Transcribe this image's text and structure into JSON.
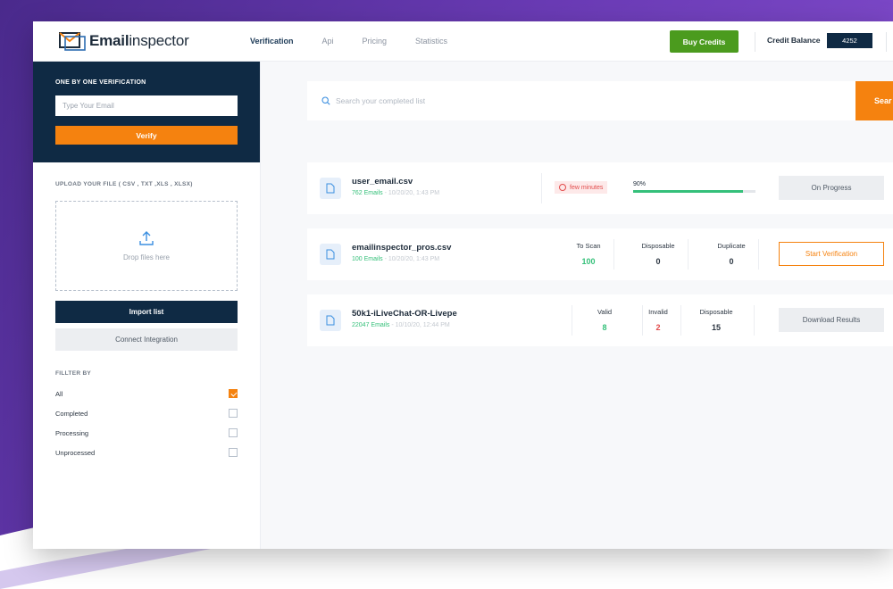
{
  "header": {
    "logo_bold": "Email",
    "logo_rest": "inspector",
    "nav": [
      {
        "label": "Verification",
        "active": true
      },
      {
        "label": "Api",
        "active": false
      },
      {
        "label": "Pricing",
        "active": false
      },
      {
        "label": "Statistics",
        "active": false
      }
    ],
    "buy_credits": "Buy Credits",
    "credit_balance_label": "Credit Balance",
    "credit_balance_value": "4252"
  },
  "sidebar": {
    "verify_title": "ONE BY ONE VERIFICATION",
    "email_placeholder": "Type Your Email",
    "verify_button": "Verify",
    "upload_label": "UPLOAD YOUR FILE ( CSV , TXT ,XLS , XLSX)",
    "drop_text": "Drop files here",
    "import_button": "Import list",
    "connect_button": "Connect Integration",
    "filter_label": "FILLTER BY",
    "filters": [
      {
        "label": "All",
        "checked": true
      },
      {
        "label": "Completed",
        "checked": false
      },
      {
        "label": "Processing",
        "checked": false
      },
      {
        "label": "Unprocessed",
        "checked": false
      }
    ]
  },
  "search": {
    "placeholder": "Search your completed list",
    "button": "Sear"
  },
  "lists": [
    {
      "name": "user_email.csv",
      "count": "762 Emails",
      "date": " - 10/20/20, 1:43 PM",
      "time_badge": "few minutes",
      "progress_label": "90%",
      "progress": 0.9,
      "action": "On Progress"
    },
    {
      "name": "emailinspector_pros.csv",
      "count": "100 Emails",
      "date": " - 10/20/20, 1:43 PM",
      "stats": [
        {
          "label": "To Scan",
          "value": "100"
        },
        {
          "label": "Disposable",
          "value": "0"
        },
        {
          "label": "Duplicate",
          "value": "0"
        }
      ],
      "action": "Start Verification"
    },
    {
      "name": "50k1-iLiveChat-OR-Livepe",
      "count": "22047 Emails",
      "date": " - 10/10/20, 12:44 PM",
      "stats": [
        {
          "label": "Valid",
          "value": "8"
        },
        {
          "label": "Invalid",
          "value": "2"
        },
        {
          "label": "Disposable",
          "value": "15"
        }
      ],
      "action": "Download Results"
    }
  ],
  "colors": {
    "navy": "#0f2a44",
    "orange": "#f5820f",
    "green": "#35c07a",
    "buy_green": "#4b9b1e",
    "red": "#e24b4b"
  }
}
